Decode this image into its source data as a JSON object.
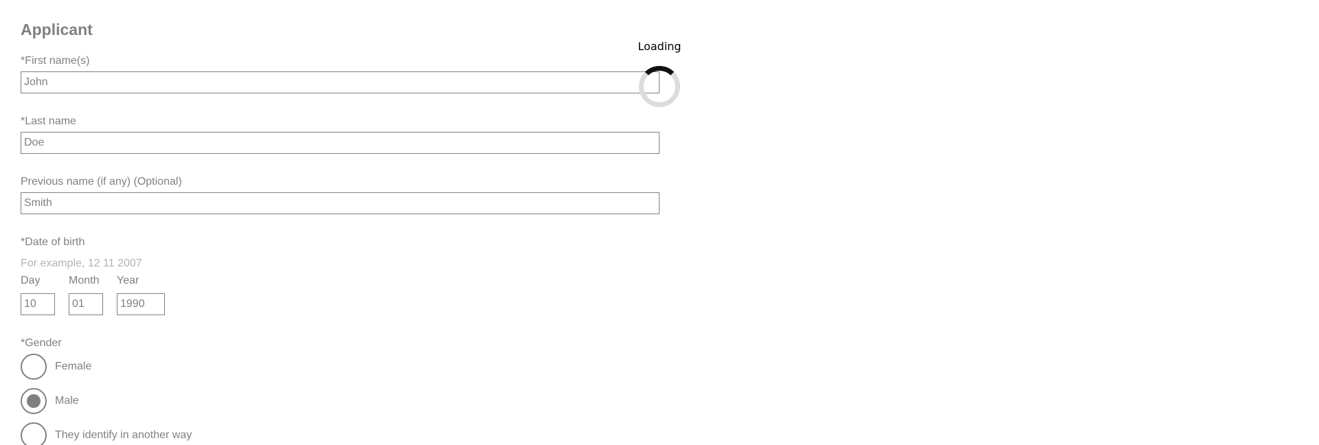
{
  "section": {
    "title": "Applicant"
  },
  "first_name": {
    "label": "*First name(s)",
    "value": "John"
  },
  "last_name": {
    "label": "*Last name",
    "value": "Doe"
  },
  "previous_name": {
    "label": "Previous name (if any) (Optional)",
    "value": "Smith"
  },
  "date_of_birth": {
    "label": "*Date of birth",
    "hint": "For example, 12 11 2007",
    "day_label": "Day",
    "day_value": "10",
    "month_label": "Month",
    "month_value": "01",
    "year_label": "Year",
    "year_value": "1990"
  },
  "gender": {
    "label": "*Gender",
    "options": [
      {
        "label": "Female",
        "selected": false
      },
      {
        "label": "Male",
        "selected": true
      },
      {
        "label": "They identify in another way",
        "selected": false
      }
    ]
  },
  "loader": {
    "text": "Loading"
  },
  "colors": {
    "text": "#808080",
    "hint": "#b3b3b3",
    "border": "#808080",
    "spinner_track": "#dcdcdc",
    "spinner_arc": "#111111"
  }
}
